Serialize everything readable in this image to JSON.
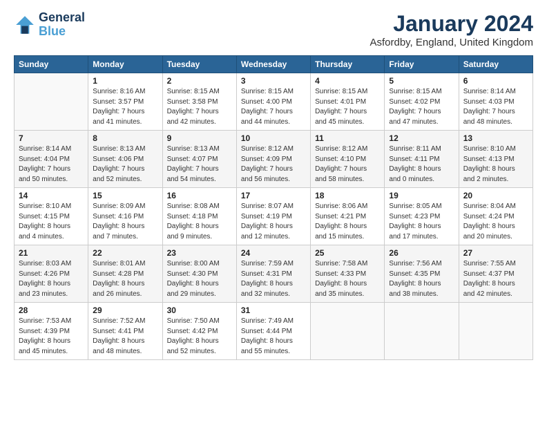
{
  "header": {
    "logo_line1": "General",
    "logo_line2": "Blue",
    "title": "January 2024",
    "subtitle": "Asfordby, England, United Kingdom"
  },
  "weekdays": [
    "Sunday",
    "Monday",
    "Tuesday",
    "Wednesday",
    "Thursday",
    "Friday",
    "Saturday"
  ],
  "weeks": [
    [
      {
        "day": "",
        "info": ""
      },
      {
        "day": "1",
        "info": "Sunrise: 8:16 AM\nSunset: 3:57 PM\nDaylight: 7 hours\nand 41 minutes."
      },
      {
        "day": "2",
        "info": "Sunrise: 8:15 AM\nSunset: 3:58 PM\nDaylight: 7 hours\nand 42 minutes."
      },
      {
        "day": "3",
        "info": "Sunrise: 8:15 AM\nSunset: 4:00 PM\nDaylight: 7 hours\nand 44 minutes."
      },
      {
        "day": "4",
        "info": "Sunrise: 8:15 AM\nSunset: 4:01 PM\nDaylight: 7 hours\nand 45 minutes."
      },
      {
        "day": "5",
        "info": "Sunrise: 8:15 AM\nSunset: 4:02 PM\nDaylight: 7 hours\nand 47 minutes."
      },
      {
        "day": "6",
        "info": "Sunrise: 8:14 AM\nSunset: 4:03 PM\nDaylight: 7 hours\nand 48 minutes."
      }
    ],
    [
      {
        "day": "7",
        "info": "Sunrise: 8:14 AM\nSunset: 4:04 PM\nDaylight: 7 hours\nand 50 minutes."
      },
      {
        "day": "8",
        "info": "Sunrise: 8:13 AM\nSunset: 4:06 PM\nDaylight: 7 hours\nand 52 minutes."
      },
      {
        "day": "9",
        "info": "Sunrise: 8:13 AM\nSunset: 4:07 PM\nDaylight: 7 hours\nand 54 minutes."
      },
      {
        "day": "10",
        "info": "Sunrise: 8:12 AM\nSunset: 4:09 PM\nDaylight: 7 hours\nand 56 minutes."
      },
      {
        "day": "11",
        "info": "Sunrise: 8:12 AM\nSunset: 4:10 PM\nDaylight: 7 hours\nand 58 minutes."
      },
      {
        "day": "12",
        "info": "Sunrise: 8:11 AM\nSunset: 4:11 PM\nDaylight: 8 hours\nand 0 minutes."
      },
      {
        "day": "13",
        "info": "Sunrise: 8:10 AM\nSunset: 4:13 PM\nDaylight: 8 hours\nand 2 minutes."
      }
    ],
    [
      {
        "day": "14",
        "info": "Sunrise: 8:10 AM\nSunset: 4:15 PM\nDaylight: 8 hours\nand 4 minutes."
      },
      {
        "day": "15",
        "info": "Sunrise: 8:09 AM\nSunset: 4:16 PM\nDaylight: 8 hours\nand 7 minutes."
      },
      {
        "day": "16",
        "info": "Sunrise: 8:08 AM\nSunset: 4:18 PM\nDaylight: 8 hours\nand 9 minutes."
      },
      {
        "day": "17",
        "info": "Sunrise: 8:07 AM\nSunset: 4:19 PM\nDaylight: 8 hours\nand 12 minutes."
      },
      {
        "day": "18",
        "info": "Sunrise: 8:06 AM\nSunset: 4:21 PM\nDaylight: 8 hours\nand 15 minutes."
      },
      {
        "day": "19",
        "info": "Sunrise: 8:05 AM\nSunset: 4:23 PM\nDaylight: 8 hours\nand 17 minutes."
      },
      {
        "day": "20",
        "info": "Sunrise: 8:04 AM\nSunset: 4:24 PM\nDaylight: 8 hours\nand 20 minutes."
      }
    ],
    [
      {
        "day": "21",
        "info": "Sunrise: 8:03 AM\nSunset: 4:26 PM\nDaylight: 8 hours\nand 23 minutes."
      },
      {
        "day": "22",
        "info": "Sunrise: 8:01 AM\nSunset: 4:28 PM\nDaylight: 8 hours\nand 26 minutes."
      },
      {
        "day": "23",
        "info": "Sunrise: 8:00 AM\nSunset: 4:30 PM\nDaylight: 8 hours\nand 29 minutes."
      },
      {
        "day": "24",
        "info": "Sunrise: 7:59 AM\nSunset: 4:31 PM\nDaylight: 8 hours\nand 32 minutes."
      },
      {
        "day": "25",
        "info": "Sunrise: 7:58 AM\nSunset: 4:33 PM\nDaylight: 8 hours\nand 35 minutes."
      },
      {
        "day": "26",
        "info": "Sunrise: 7:56 AM\nSunset: 4:35 PM\nDaylight: 8 hours\nand 38 minutes."
      },
      {
        "day": "27",
        "info": "Sunrise: 7:55 AM\nSunset: 4:37 PM\nDaylight: 8 hours\nand 42 minutes."
      }
    ],
    [
      {
        "day": "28",
        "info": "Sunrise: 7:53 AM\nSunset: 4:39 PM\nDaylight: 8 hours\nand 45 minutes."
      },
      {
        "day": "29",
        "info": "Sunrise: 7:52 AM\nSunset: 4:41 PM\nDaylight: 8 hours\nand 48 minutes."
      },
      {
        "day": "30",
        "info": "Sunrise: 7:50 AM\nSunset: 4:42 PM\nDaylight: 8 hours\nand 52 minutes."
      },
      {
        "day": "31",
        "info": "Sunrise: 7:49 AM\nSunset: 4:44 PM\nDaylight: 8 hours\nand 55 minutes."
      },
      {
        "day": "",
        "info": ""
      },
      {
        "day": "",
        "info": ""
      },
      {
        "day": "",
        "info": ""
      }
    ]
  ]
}
